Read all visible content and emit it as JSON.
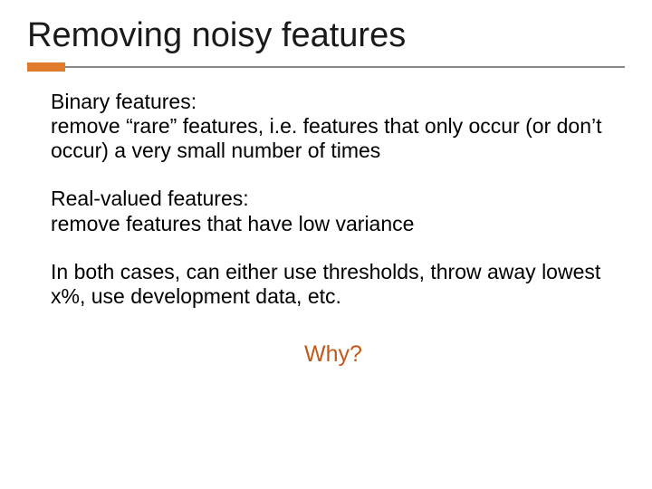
{
  "title": "Removing noisy features",
  "blocks": [
    {
      "heading": "Binary features:",
      "text": "remove “rare” features, i.e. features that only occur (or don’t occur) a very small number of times"
    },
    {
      "heading": "Real-valued features:",
      "text": "remove features that have low variance"
    },
    {
      "heading": "",
      "text": "In both cases, can either use thresholds, throw away lowest x%, use development data, etc."
    }
  ],
  "callout": "Why?",
  "accent_color": "#c05a1a",
  "bar_color": "#e07b2e"
}
